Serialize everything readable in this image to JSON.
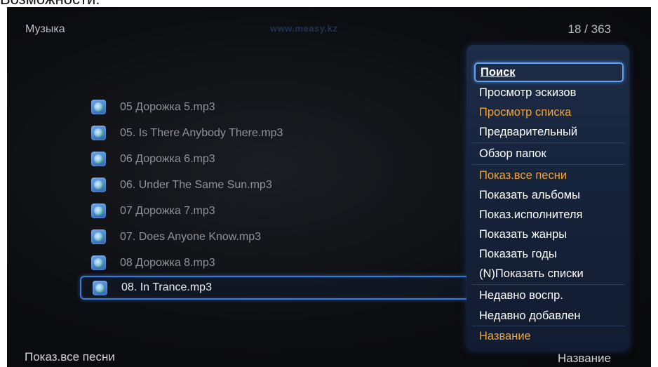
{
  "page_caption": "Возможности.",
  "header": {
    "title": "Музыка",
    "watermark": "www.measy.kz",
    "counter": "18 / 363"
  },
  "files": [
    {
      "name": "05 Дорожка 5.mp3",
      "selected": false
    },
    {
      "name": "05. Is There Anybody There.mp3",
      "selected": false
    },
    {
      "name": "06 Дорожка 6.mp3",
      "selected": false
    },
    {
      "name": "06. Under The Same Sun.mp3",
      "selected": false
    },
    {
      "name": "07 Дорожка 7.mp3",
      "selected": false
    },
    {
      "name": "07. Does Anyone Know.mp3",
      "selected": false
    },
    {
      "name": "08 Дорожка 8.mp3",
      "selected": false
    },
    {
      "name": "08. In Trance.mp3",
      "selected": true
    }
  ],
  "menu": {
    "items": [
      {
        "label": "Поиск",
        "state": "focused"
      },
      {
        "label": "Просмотр эскизов",
        "state": "normal"
      },
      {
        "label": "Просмотр списка",
        "state": "highlight"
      },
      {
        "label": "Предварительный",
        "state": "normal"
      },
      {
        "label": "Обзор папок",
        "state": "normal"
      },
      {
        "label": "Показ.все песни",
        "state": "highlight"
      },
      {
        "label": "Показать альбомы",
        "state": "normal"
      },
      {
        "label": "Показ.исполнителя",
        "state": "normal"
      },
      {
        "label": "Показать жанры",
        "state": "normal"
      },
      {
        "label": "Показать годы",
        "state": "normal"
      },
      {
        "label": "(N)Показать списки",
        "state": "normal"
      },
      {
        "label": "Недавно воспр.",
        "state": "normal"
      },
      {
        "label": "Недавно добавлен",
        "state": "normal"
      },
      {
        "label": "Название",
        "state": "highlight"
      }
    ]
  },
  "footer": {
    "left": "Показ.все песни",
    "right": "Название"
  },
  "colors": {
    "accent_orange": "#f0a53a",
    "selection_blue": "#3a79d6",
    "menu_bg": "#1a2843"
  },
  "icons": {
    "file": "music-file-icon"
  }
}
